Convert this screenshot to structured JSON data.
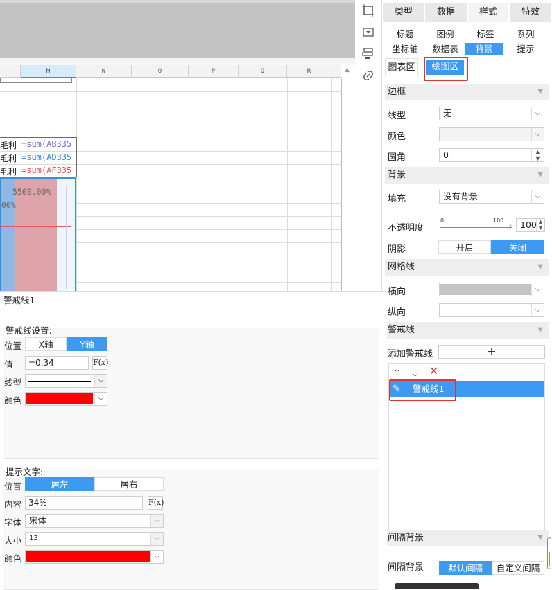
{
  "colors": {
    "accent": "#3d9af2",
    "red": "#ff0000",
    "highlight": "#e0322e"
  },
  "sheet": {
    "columns": [
      "M",
      "N",
      "O",
      "P",
      "Q",
      "R"
    ],
    "rows": [
      {
        "a": "毛利",
        "b": "=sum(AB335"
      },
      {
        "a": "毛利",
        "b": "=sum(AD335"
      },
      {
        "a": "毛利",
        "b": "=sum(AF335"
      }
    ],
    "chart_label1": "5500.00%",
    "chart_label2": "00%"
  },
  "icons": [
    "frame-icon",
    "dropdown-box-icon",
    "layers-icon",
    "link-icon"
  ],
  "panel": {
    "tabs": [
      "类型",
      "数据",
      "样式",
      "特效"
    ],
    "subtabs_row1": [
      "标题",
      "图例",
      "标签",
      "系列"
    ],
    "subtabs_row2": [
      "坐标轴",
      "数据表",
      "背景",
      "提示"
    ],
    "area_tabs": [
      "图表区",
      "绘图区"
    ],
    "border": {
      "section": "边框",
      "line_type_label": "线型",
      "line_type_value": "无",
      "color_label": "颜色",
      "radius_label": "圆角",
      "radius_value": "0"
    },
    "background": {
      "section": "背景",
      "fill_label": "填充",
      "fill_value": "没有背景",
      "opacity_label": "不透明度",
      "slider_min": "0",
      "slider_max": "100",
      "opacity_value": "100",
      "shadow_label": "阴影",
      "shadow_on": "开启",
      "shadow_off": "关闭"
    },
    "grid": {
      "section": "网格线",
      "horizontal_label": "横向",
      "vertical_label": "纵向"
    },
    "alert": {
      "section": "警戒线",
      "add_label": "添加警戒线",
      "add_icon": "+",
      "item": "警戒线1"
    },
    "stripe": {
      "section": "间隔背景",
      "label": "间隔背景",
      "default": "默认间隔",
      "custom": "自定义间隔"
    }
  },
  "dialog": {
    "title": "警戒线1",
    "settings": {
      "group": "警戒线设置:",
      "position_label": "位置",
      "x_axis": "X轴",
      "y_axis": "Y轴",
      "value_label": "值",
      "value": "=0.34",
      "fx": "F(x)",
      "line_type_label": "线型",
      "color_label": "颜色"
    },
    "tip": {
      "group": "提示文字:",
      "position_label": "位置",
      "left": "居左",
      "right": "居右",
      "content_label": "内容",
      "content": "34%",
      "fx": "F(x)",
      "font_label": "字体",
      "font": "宋体",
      "size_label": "大小",
      "size": "13",
      "color_label": "颜色"
    }
  }
}
